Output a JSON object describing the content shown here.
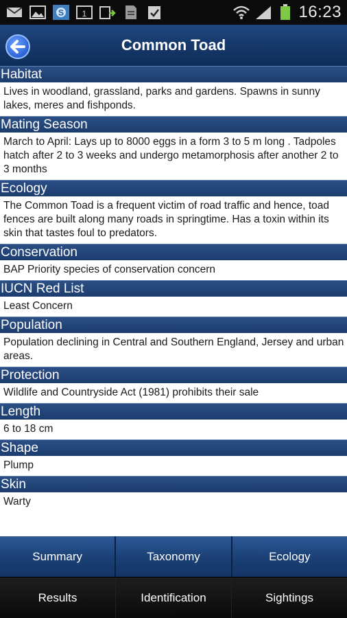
{
  "status_bar": {
    "time": "16:23",
    "icons": [
      "mail-icon",
      "image-icon",
      "skype-icon",
      "calendar-icon",
      "download-icon",
      "file-icon",
      "clipboard-check-icon"
    ],
    "right_icons": [
      "wifi-icon",
      "signal-icon",
      "battery-icon"
    ]
  },
  "header": {
    "title": "Common Toad",
    "back_icon": "back-arrow-icon"
  },
  "sections": [
    {
      "heading": "Habitat",
      "text": "Lives in woodland, grassland, parks and gardens. Spawns in sunny lakes, meres and fishponds."
    },
    {
      "heading": "Mating Season",
      "text": "March to April: Lays up to 8000 eggs in a form 3 to 5 m long . Tadpoles hatch after 2 to 3 weeks and undergo metamorphosis after another 2 to 3 months"
    },
    {
      "heading": "Ecology",
      "text": "The Common Toad is a frequent victim of road traffic and hence, toad fences are built along many roads in springtime. Has a toxin within its skin that tastes foul to predators."
    },
    {
      "heading": "Conservation",
      "text": "BAP Priority species of conservation concern"
    },
    {
      "heading": "IUCN Red List",
      "text": "Least Concern"
    },
    {
      "heading": "Population",
      "text": "Population declining in Central and Southern England, Jersey and urban areas."
    },
    {
      "heading": "Protection",
      "text": "Wildlife and Countryside Act (1981) prohibits their sale"
    },
    {
      "heading": "Length",
      "text": "6 to 18 cm"
    },
    {
      "heading": "Shape",
      "text": "Plump"
    },
    {
      "heading": "Skin",
      "text": "Warty"
    }
  ],
  "tabs_top": [
    "Summary",
    "Taxonomy",
    "Ecology"
  ],
  "tabs_bottom": [
    "Results",
    "Identification",
    "Sightings"
  ],
  "colors": {
    "header_blue": "#1c3c6e",
    "tab_blue": "#2d5a97",
    "background": "#ffffff"
  }
}
